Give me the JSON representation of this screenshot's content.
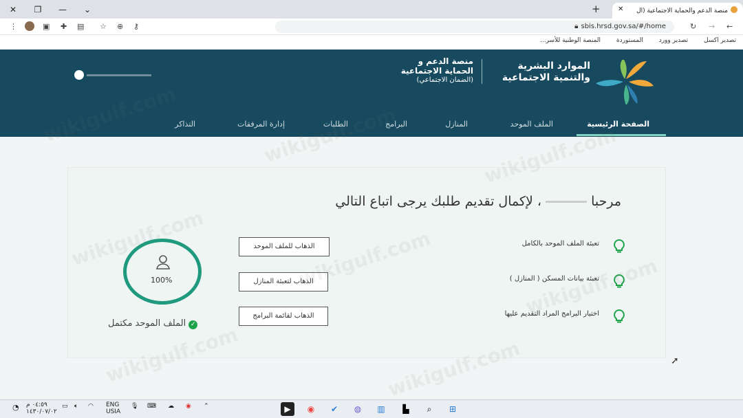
{
  "browser": {
    "tab_title": "منصة الدعم والحماية الاجتماعية (ال",
    "url": "sbis.hrsd.gov.sa/#/home",
    "bookmarks": [
      "تصدير اكسل",
      "تصدير وورد",
      "المستوردة",
      "المنصة الوطنية للأسر..."
    ]
  },
  "header": {
    "ministry_line1": "الموارد البشرية",
    "ministry_line2": "والتنمية الاجتماعية",
    "platform_line1": "منصة الدعم و",
    "platform_line2": "الحماية الاجتماعية",
    "platform_line3": "(الضمان الاجتماعي)"
  },
  "nav": {
    "items": [
      "الصفحة الرئيسية",
      "الملف الموحد",
      "المنازل",
      "البرامج",
      "الطلبات",
      "إدارة المرفقات",
      "التذاكر"
    ]
  },
  "main": {
    "welcome_prefix": "مرحبا",
    "welcome_suffix": "، لإكمال تقديم طلبك يرجى اتباع التالي",
    "steps": [
      {
        "label": "تعبئة الملف الموحد بالكامل",
        "button": "الذهاب للملف الموحد"
      },
      {
        "label": "تعبئة بيانات المسكن ( المنازل )",
        "button": "الذهاب لتعبئة المنازل"
      },
      {
        "label": "اختيار البرامج المراد التقديم عليها",
        "button": "الذهاب لقائمة البرامج"
      }
    ],
    "progress_percent": "100%",
    "progress_value": 100,
    "profile_status": "الملف الموحد مكتمل"
  },
  "taskbar": {
    "lang": "ENG",
    "region": "USIA",
    "time": "٠٤:٥٩ م",
    "date": "١٤٣٠/٠٧/٠٢"
  },
  "watermark": "wikigulf.com",
  "colors": {
    "header_bg": "#184a5f",
    "accent": "#1f9a7e",
    "check": "#1fa34a",
    "bulb": "#1fa34a"
  }
}
